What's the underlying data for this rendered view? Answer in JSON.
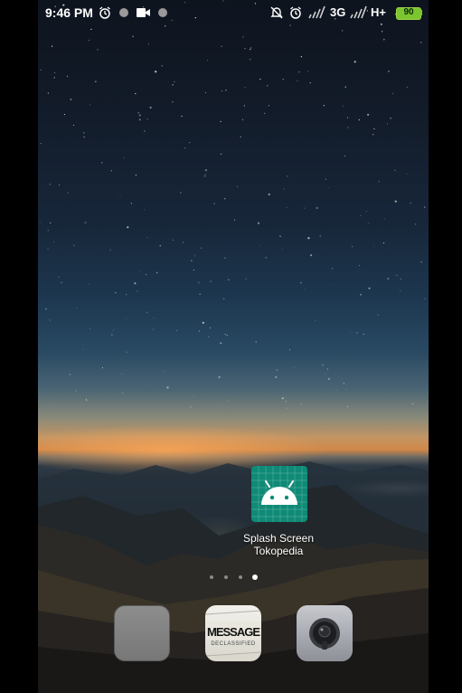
{
  "status_bar": {
    "time": "9:46 PM",
    "left_icons": [
      "alarm-icon",
      "notification-dot-icon",
      "video-camera-icon",
      "notification-dot-icon"
    ],
    "right_icons": [
      "silent-mode-icon",
      "alarm-icon",
      "signal-icon",
      "signal-icon"
    ],
    "network_1": "3G",
    "network_2": "H+",
    "battery_level": "90",
    "battery_color": "#7bc62d"
  },
  "home": {
    "app": {
      "label": "Splash Screen Tokopedia",
      "icon": "android-robot-icon",
      "icon_bg": "#0e8a76"
    },
    "page_indicator": {
      "pages": 4,
      "current": 4
    },
    "dock": [
      {
        "name": "gray-folder-icon"
      },
      {
        "name": "message-app-icon",
        "text": "MESSAGE",
        "subtext": "DECLASSIFIED"
      },
      {
        "name": "camera-app-icon"
      }
    ]
  }
}
